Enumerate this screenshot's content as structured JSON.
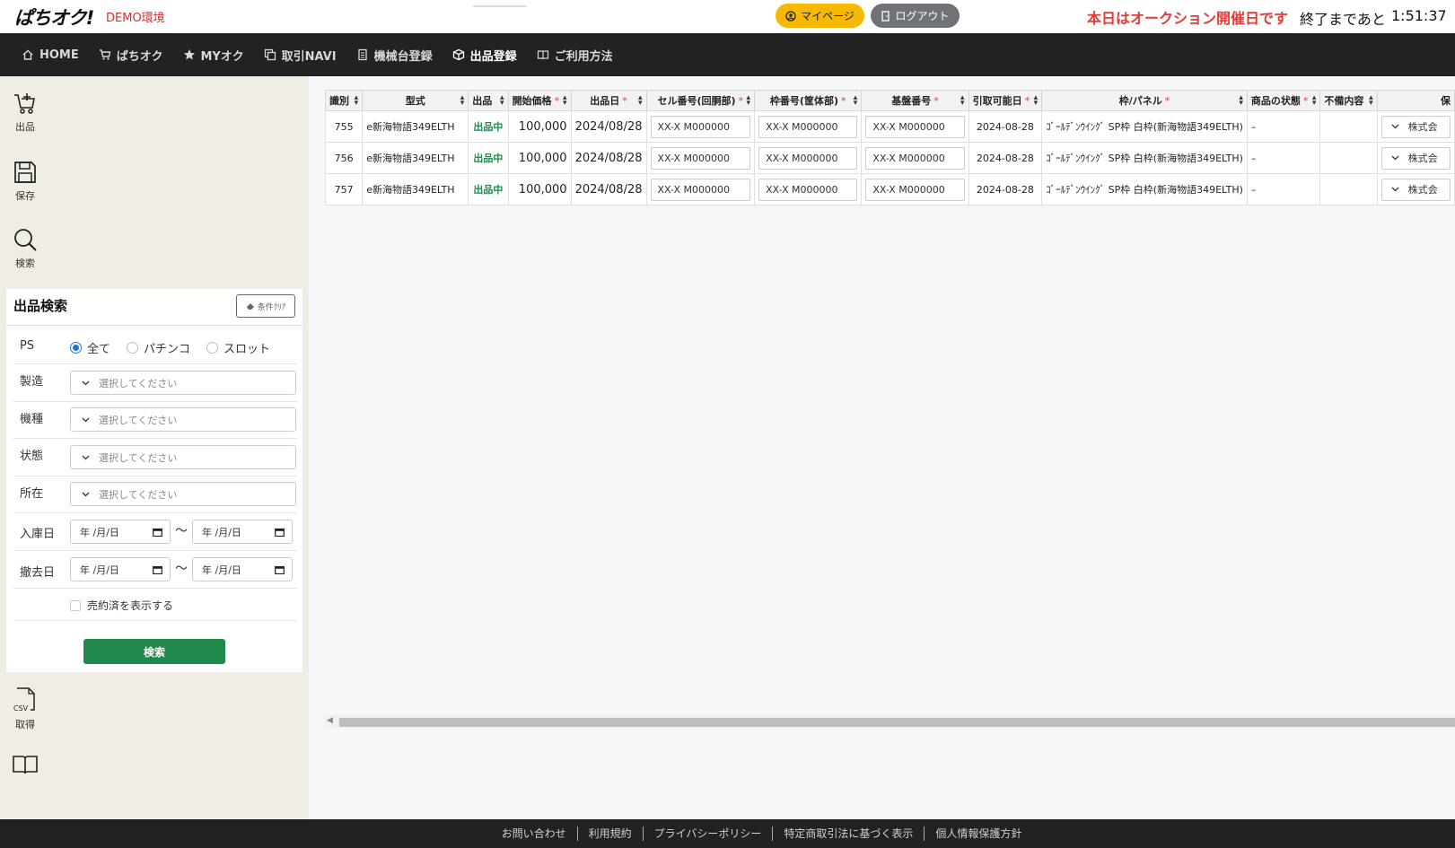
{
  "header": {
    "logo": "ぱちオク!",
    "env_tag": "DEMO環境",
    "mypage_label": "マイページ",
    "logout_label": "ログアウト",
    "auction_message": "本日はオークション開催日です",
    "countdown_label": "終了まであと",
    "countdown_value": "1:51:37"
  },
  "nav": {
    "items": [
      {
        "label": "HOME",
        "icon": "home-icon"
      },
      {
        "label": "ぱちオク",
        "icon": "cart-icon"
      },
      {
        "label": "MYオク",
        "icon": "star-icon"
      },
      {
        "label": "取引NAVI",
        "icon": "copy-icon"
      },
      {
        "label": "機械台登録",
        "icon": "document-icon"
      },
      {
        "label": "出品登録",
        "icon": "box-icon",
        "active": true
      },
      {
        "label": "ご利用方法",
        "icon": "book-icon"
      }
    ]
  },
  "sidebar": {
    "tools": {
      "listing": "出品",
      "save": "保存",
      "search": "検索",
      "csv": "取得",
      "csv_icon_text": "CSV"
    }
  },
  "search_panel": {
    "title": "出品検索",
    "clear_label": "条件ｸﾘｱ",
    "ps_label": "PS",
    "ps_options": [
      "全て",
      "パチンコ",
      "スロット"
    ],
    "ps_selected": "全て",
    "maker_label": "製造",
    "model_label": "機種",
    "state_label": "状態",
    "location_label": "所在",
    "select_placeholder": "選択してください",
    "received_label": "入庫日",
    "removed_label": "撤去日",
    "date_placeholder": "年 /月/日",
    "range_sep": "〜",
    "show_sold_label": "売約済を表示する",
    "search_button": "検索"
  },
  "table": {
    "columns": [
      {
        "label": "識別",
        "required": false
      },
      {
        "label": "型式",
        "required": false
      },
      {
        "label": "出品",
        "required": false
      },
      {
        "label": "開始価格",
        "required": true
      },
      {
        "label": "出品日",
        "required": true
      },
      {
        "label": "セル番号(回胴部)",
        "required": true
      },
      {
        "label": "枠番号(筐体部)",
        "required": true
      },
      {
        "label": "基盤番号",
        "required": true
      },
      {
        "label": "引取可能日",
        "required": true
      },
      {
        "label": "枠/パネル",
        "required": true
      },
      {
        "label": "商品の状態",
        "required": true
      },
      {
        "label": "不備内容",
        "required": false
      },
      {
        "label": "保",
        "required": false
      }
    ],
    "input_placeholder": "XX-X M000000",
    "rows": [
      {
        "id": "755",
        "model": "e新海物語349ELTH",
        "status": "出品中",
        "price": "100,000",
        "date": "2024/08/28",
        "pickup": "2024-08-28",
        "panel": "ｺﾞｰﾙﾃﾞﾝｳｲﾝｸﾞ SP枠 白枠(新海物語349ELTH)",
        "condition": "–",
        "defect": "",
        "storage": "株式会"
      },
      {
        "id": "756",
        "model": "e新海物語349ELTH",
        "status": "出品中",
        "price": "100,000",
        "date": "2024/08/28",
        "pickup": "2024-08-28",
        "panel": "ｺﾞｰﾙﾃﾞﾝｳｲﾝｸﾞ SP枠 白枠(新海物語349ELTH)",
        "condition": "–",
        "defect": "",
        "storage": "株式会"
      },
      {
        "id": "757",
        "model": "e新海物語349ELTH",
        "status": "出品中",
        "price": "100,000",
        "date": "2024/08/28",
        "pickup": "2024-08-28",
        "panel": "ｺﾞｰﾙﾃﾞﾝｳｲﾝｸﾞ SP枠 白枠(新海物語349ELTH)",
        "condition": "–",
        "defect": "",
        "storage": "株式会"
      }
    ]
  },
  "footer": {
    "links": [
      "お問い合わせ",
      "利用規約",
      "プライバシーポリシー",
      "特定商取引法に基づく表示",
      "個人情報保護方針"
    ]
  },
  "colors": {
    "accent_red": "#e53935",
    "status_green": "#1f8a4c",
    "mypage_yellow": "#f6b800",
    "nav_dark": "#222222",
    "sidebar_beige": "#f0ede4"
  }
}
